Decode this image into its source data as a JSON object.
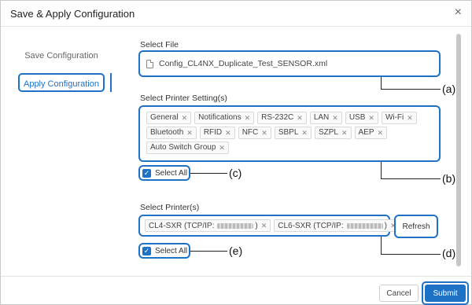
{
  "dialog": {
    "title": "Save & Apply Configuration",
    "close_glyph": "×"
  },
  "sidebar": {
    "items": [
      {
        "label": "Save Configuration"
      },
      {
        "label": "Apply Configuration"
      }
    ]
  },
  "select_file": {
    "label": "Select File",
    "value": "Config_CL4NX_Duplicate_Test_SENSOR.xml"
  },
  "printer_settings": {
    "label": "Select Printer Setting(s)",
    "tags": [
      "General",
      "Notifications",
      "RS-232C",
      "LAN",
      "USB",
      "Wi-Fi",
      "Bluetooth",
      "RFID",
      "NFC",
      "SBPL",
      "SZPL",
      "AEP",
      "Auto Switch Group"
    ],
    "select_all": "Select All"
  },
  "printers": {
    "label": "Select Printer(s)",
    "tags": [
      {
        "prefix": "CL4-SXR (TCP/IP:",
        "suffix": ")"
      },
      {
        "prefix": "CL6-SXR (TCP/IP:",
        "suffix": ")"
      }
    ],
    "refresh": "Refresh",
    "select_all": "Select All"
  },
  "callouts": {
    "a": "(a)",
    "b": "(b)",
    "c": "(c)",
    "d": "(d)",
    "e": "(e)"
  },
  "footer": {
    "cancel": "Cancel",
    "submit": "Submit"
  },
  "colors": {
    "accent": "#1d72c6"
  }
}
